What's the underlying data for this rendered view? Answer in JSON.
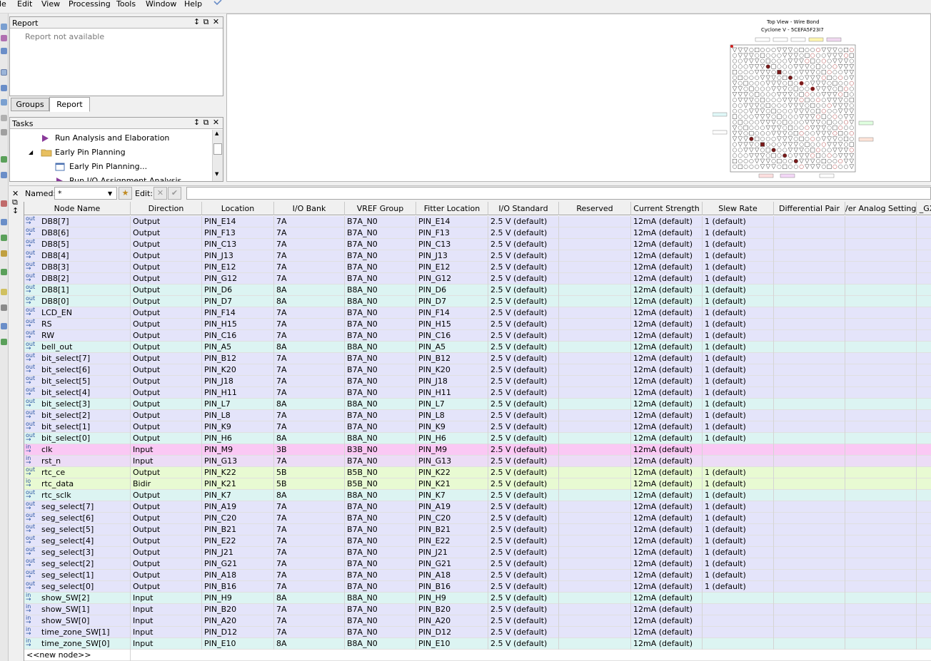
{
  "menu": [
    "le",
    "Edit",
    "View",
    "Processing",
    "Tools",
    "Window",
    "Help"
  ],
  "report_panel": {
    "title": "Report",
    "message": "Report not available"
  },
  "tabs": [
    "Groups",
    "Report"
  ],
  "tasks_panel": {
    "title": "Tasks",
    "items": [
      "Run Analysis and Elaboration",
      "Early Pin Planning",
      "Early Pin Planning...",
      "Run I/O Assignment Analysis"
    ]
  },
  "package_view": {
    "title": "Top View - Wire Bond",
    "subtitle": "Cyclone V - 5CEFA5F23I7"
  },
  "filter": {
    "named_label": "Named:",
    "named_value": "*",
    "edit_label": "Edit:"
  },
  "columns": [
    "Node Name",
    "Direction",
    "Location",
    "I/O Bank",
    "VREF Group",
    "Fitter Location",
    "I/O Standard",
    "Reserved",
    "Current Strength",
    "Slew Rate",
    "Differential Pair",
    "/er Analog Settings",
    "_GX"
  ],
  "colors": {
    "purple": "#e4e4fa",
    "cyan": "#dcf4f2",
    "pink": "#fac8f4",
    "lavender": "#ecdcf6",
    "green": "#e8fad2",
    "white": "#ffffff"
  },
  "rows": [
    {
      "icon": "out",
      "name": "DB8[7]",
      "direction": "Output",
      "location": "PIN_E14",
      "bank": "7A",
      "vref": "B7A_N0",
      "fitter": "PIN_E14",
      "standard": "2.5 V (default)",
      "reserved": "",
      "current": "12mA (default)",
      "slew": "1 (default)",
      "color": "purple"
    },
    {
      "icon": "out",
      "name": "DB8[6]",
      "direction": "Output",
      "location": "PIN_F13",
      "bank": "7A",
      "vref": "B7A_N0",
      "fitter": "PIN_F13",
      "standard": "2.5 V (default)",
      "reserved": "",
      "current": "12mA (default)",
      "slew": "1 (default)",
      "color": "purple"
    },
    {
      "icon": "out",
      "name": "DB8[5]",
      "direction": "Output",
      "location": "PIN_C13",
      "bank": "7A",
      "vref": "B7A_N0",
      "fitter": "PIN_C13",
      "standard": "2.5 V (default)",
      "reserved": "",
      "current": "12mA (default)",
      "slew": "1 (default)",
      "color": "purple"
    },
    {
      "icon": "out",
      "name": "DB8[4]",
      "direction": "Output",
      "location": "PIN_J13",
      "bank": "7A",
      "vref": "B7A_N0",
      "fitter": "PIN_J13",
      "standard": "2.5 V (default)",
      "reserved": "",
      "current": "12mA (default)",
      "slew": "1 (default)",
      "color": "purple"
    },
    {
      "icon": "out",
      "name": "DB8[3]",
      "direction": "Output",
      "location": "PIN_E12",
      "bank": "7A",
      "vref": "B7A_N0",
      "fitter": "PIN_E12",
      "standard": "2.5 V (default)",
      "reserved": "",
      "current": "12mA (default)",
      "slew": "1 (default)",
      "color": "purple"
    },
    {
      "icon": "out",
      "name": "DB8[2]",
      "direction": "Output",
      "location": "PIN_G12",
      "bank": "7A",
      "vref": "B7A_N0",
      "fitter": "PIN_G12",
      "standard": "2.5 V (default)",
      "reserved": "",
      "current": "12mA (default)",
      "slew": "1 (default)",
      "color": "purple"
    },
    {
      "icon": "out",
      "name": "DB8[1]",
      "direction": "Output",
      "location": "PIN_D6",
      "bank": "8A",
      "vref": "B8A_N0",
      "fitter": "PIN_D6",
      "standard": "2.5 V (default)",
      "reserved": "",
      "current": "12mA (default)",
      "slew": "1 (default)",
      "color": "cyan"
    },
    {
      "icon": "out",
      "name": "DB8[0]",
      "direction": "Output",
      "location": "PIN_D7",
      "bank": "8A",
      "vref": "B8A_N0",
      "fitter": "PIN_D7",
      "standard": "2.5 V (default)",
      "reserved": "",
      "current": "12mA (default)",
      "slew": "1 (default)",
      "color": "cyan"
    },
    {
      "icon": "out",
      "name": "LCD_EN",
      "direction": "Output",
      "location": "PIN_F14",
      "bank": "7A",
      "vref": "B7A_N0",
      "fitter": "PIN_F14",
      "standard": "2.5 V (default)",
      "reserved": "",
      "current": "12mA (default)",
      "slew": "1 (default)",
      "color": "purple"
    },
    {
      "icon": "out",
      "name": "RS",
      "direction": "Output",
      "location": "PIN_H15",
      "bank": "7A",
      "vref": "B7A_N0",
      "fitter": "PIN_H15",
      "standard": "2.5 V (default)",
      "reserved": "",
      "current": "12mA (default)",
      "slew": "1 (default)",
      "color": "purple"
    },
    {
      "icon": "out",
      "name": "RW",
      "direction": "Output",
      "location": "PIN_C16",
      "bank": "7A",
      "vref": "B7A_N0",
      "fitter": "PIN_C16",
      "standard": "2.5 V (default)",
      "reserved": "",
      "current": "12mA (default)",
      "slew": "1 (default)",
      "color": "purple"
    },
    {
      "icon": "out",
      "name": "bell_out",
      "direction": "Output",
      "location": "PIN_A5",
      "bank": "8A",
      "vref": "B8A_N0",
      "fitter": "PIN_A5",
      "standard": "2.5 V (default)",
      "reserved": "",
      "current": "12mA (default)",
      "slew": "1 (default)",
      "color": "cyan"
    },
    {
      "icon": "out",
      "name": "bit_select[7]",
      "direction": "Output",
      "location": "PIN_B12",
      "bank": "7A",
      "vref": "B7A_N0",
      "fitter": "PIN_B12",
      "standard": "2.5 V (default)",
      "reserved": "",
      "current": "12mA (default)",
      "slew": "1 (default)",
      "color": "purple"
    },
    {
      "icon": "out",
      "name": "bit_select[6]",
      "direction": "Output",
      "location": "PIN_K20",
      "bank": "7A",
      "vref": "B7A_N0",
      "fitter": "PIN_K20",
      "standard": "2.5 V (default)",
      "reserved": "",
      "current": "12mA (default)",
      "slew": "1 (default)",
      "color": "purple"
    },
    {
      "icon": "out",
      "name": "bit_select[5]",
      "direction": "Output",
      "location": "PIN_J18",
      "bank": "7A",
      "vref": "B7A_N0",
      "fitter": "PIN_J18",
      "standard": "2.5 V (default)",
      "reserved": "",
      "current": "12mA (default)",
      "slew": "1 (default)",
      "color": "purple"
    },
    {
      "icon": "out",
      "name": "bit_select[4]",
      "direction": "Output",
      "location": "PIN_H11",
      "bank": "7A",
      "vref": "B7A_N0",
      "fitter": "PIN_H11",
      "standard": "2.5 V (default)",
      "reserved": "",
      "current": "12mA (default)",
      "slew": "1 (default)",
      "color": "purple"
    },
    {
      "icon": "out",
      "name": "bit_select[3]",
      "direction": "Output",
      "location": "PIN_L7",
      "bank": "8A",
      "vref": "B8A_N0",
      "fitter": "PIN_L7",
      "standard": "2.5 V (default)",
      "reserved": "",
      "current": "12mA (default)",
      "slew": "1 (default)",
      "color": "cyan"
    },
    {
      "icon": "out",
      "name": "bit_select[2]",
      "direction": "Output",
      "location": "PIN_L8",
      "bank": "7A",
      "vref": "B7A_N0",
      "fitter": "PIN_L8",
      "standard": "2.5 V (default)",
      "reserved": "",
      "current": "12mA (default)",
      "slew": "1 (default)",
      "color": "purple"
    },
    {
      "icon": "out",
      "name": "bit_select[1]",
      "direction": "Output",
      "location": "PIN_K9",
      "bank": "7A",
      "vref": "B7A_N0",
      "fitter": "PIN_K9",
      "standard": "2.5 V (default)",
      "reserved": "",
      "current": "12mA (default)",
      "slew": "1 (default)",
      "color": "purple"
    },
    {
      "icon": "out",
      "name": "bit_select[0]",
      "direction": "Output",
      "location": "PIN_H6",
      "bank": "8A",
      "vref": "B8A_N0",
      "fitter": "PIN_H6",
      "standard": "2.5 V (default)",
      "reserved": "",
      "current": "12mA (default)",
      "slew": "1 (default)",
      "color": "cyan"
    },
    {
      "icon": "in",
      "name": "clk",
      "direction": "Input",
      "location": "PIN_M9",
      "bank": "3B",
      "vref": "B3B_N0",
      "fitter": "PIN_M9",
      "standard": "2.5 V (default)",
      "reserved": "",
      "current": "12mA (default)",
      "slew": "",
      "color": "pink"
    },
    {
      "icon": "in",
      "name": "rst_n",
      "direction": "Input",
      "location": "PIN_G13",
      "bank": "7A",
      "vref": "B7A_N0",
      "fitter": "PIN_G13",
      "standard": "2.5 V (default)",
      "reserved": "",
      "current": "12mA (default)",
      "slew": "",
      "color": "lavender"
    },
    {
      "icon": "out",
      "name": "rtc_ce",
      "direction": "Output",
      "location": "PIN_K22",
      "bank": "5B",
      "vref": "B5B_N0",
      "fitter": "PIN_K22",
      "standard": "2.5 V (default)",
      "reserved": "",
      "current": "12mA (default)",
      "slew": "1 (default)",
      "color": "green"
    },
    {
      "icon": "io",
      "name": "rtc_data",
      "direction": "Bidir",
      "location": "PIN_K21",
      "bank": "5B",
      "vref": "B5B_N0",
      "fitter": "PIN_K21",
      "standard": "2.5 V (default)",
      "reserved": "",
      "current": "12mA (default)",
      "slew": "1 (default)",
      "color": "green"
    },
    {
      "icon": "out",
      "name": "rtc_sclk",
      "direction": "Output",
      "location": "PIN_K7",
      "bank": "8A",
      "vref": "B8A_N0",
      "fitter": "PIN_K7",
      "standard": "2.5 V (default)",
      "reserved": "",
      "current": "12mA (default)",
      "slew": "1 (default)",
      "color": "cyan"
    },
    {
      "icon": "out",
      "name": "seg_select[7]",
      "direction": "Output",
      "location": "PIN_A19",
      "bank": "7A",
      "vref": "B7A_N0",
      "fitter": "PIN_A19",
      "standard": "2.5 V (default)",
      "reserved": "",
      "current": "12mA (default)",
      "slew": "1 (default)",
      "color": "purple"
    },
    {
      "icon": "out",
      "name": "seg_select[6]",
      "direction": "Output",
      "location": "PIN_C20",
      "bank": "7A",
      "vref": "B7A_N0",
      "fitter": "PIN_C20",
      "standard": "2.5 V (default)",
      "reserved": "",
      "current": "12mA (default)",
      "slew": "1 (default)",
      "color": "purple"
    },
    {
      "icon": "out",
      "name": "seg_select[5]",
      "direction": "Output",
      "location": "PIN_B21",
      "bank": "7A",
      "vref": "B7A_N0",
      "fitter": "PIN_B21",
      "standard": "2.5 V (default)",
      "reserved": "",
      "current": "12mA (default)",
      "slew": "1 (default)",
      "color": "purple"
    },
    {
      "icon": "out",
      "name": "seg_select[4]",
      "direction": "Output",
      "location": "PIN_E22",
      "bank": "7A",
      "vref": "B7A_N0",
      "fitter": "PIN_E22",
      "standard": "2.5 V (default)",
      "reserved": "",
      "current": "12mA (default)",
      "slew": "1 (default)",
      "color": "purple"
    },
    {
      "icon": "out",
      "name": "seg_select[3]",
      "direction": "Output",
      "location": "PIN_J21",
      "bank": "7A",
      "vref": "B7A_N0",
      "fitter": "PIN_J21",
      "standard": "2.5 V (default)",
      "reserved": "",
      "current": "12mA (default)",
      "slew": "1 (default)",
      "color": "purple"
    },
    {
      "icon": "out",
      "name": "seg_select[2]",
      "direction": "Output",
      "location": "PIN_G21",
      "bank": "7A",
      "vref": "B7A_N0",
      "fitter": "PIN_G21",
      "standard": "2.5 V (default)",
      "reserved": "",
      "current": "12mA (default)",
      "slew": "1 (default)",
      "color": "purple"
    },
    {
      "icon": "out",
      "name": "seg_select[1]",
      "direction": "Output",
      "location": "PIN_A18",
      "bank": "7A",
      "vref": "B7A_N0",
      "fitter": "PIN_A18",
      "standard": "2.5 V (default)",
      "reserved": "",
      "current": "12mA (default)",
      "slew": "1 (default)",
      "color": "purple"
    },
    {
      "icon": "out",
      "name": "seg_select[0]",
      "direction": "Output",
      "location": "PIN_B16",
      "bank": "7A",
      "vref": "B7A_N0",
      "fitter": "PIN_B16",
      "standard": "2.5 V (default)",
      "reserved": "",
      "current": "12mA (default)",
      "slew": "1 (default)",
      "color": "purple"
    },
    {
      "icon": "in",
      "name": "show_SW[2]",
      "direction": "Input",
      "location": "PIN_H9",
      "bank": "8A",
      "vref": "B8A_N0",
      "fitter": "PIN_H9",
      "standard": "2.5 V (default)",
      "reserved": "",
      "current": "12mA (default)",
      "slew": "",
      "color": "cyan"
    },
    {
      "icon": "in",
      "name": "show_SW[1]",
      "direction": "Input",
      "location": "PIN_B20",
      "bank": "7A",
      "vref": "B7A_N0",
      "fitter": "PIN_B20",
      "standard": "2.5 V (default)",
      "reserved": "",
      "current": "12mA (default)",
      "slew": "",
      "color": "purple"
    },
    {
      "icon": "in",
      "name": "show_SW[0]",
      "direction": "Input",
      "location": "PIN_A20",
      "bank": "7A",
      "vref": "B7A_N0",
      "fitter": "PIN_A20",
      "standard": "2.5 V (default)",
      "reserved": "",
      "current": "12mA (default)",
      "slew": "",
      "color": "purple"
    },
    {
      "icon": "in",
      "name": "time_zone_SW[1]",
      "direction": "Input",
      "location": "PIN_D12",
      "bank": "7A",
      "vref": "B7A_N0",
      "fitter": "PIN_D12",
      "standard": "2.5 V (default)",
      "reserved": "",
      "current": "12mA (default)",
      "slew": "",
      "color": "purple"
    },
    {
      "icon": "in",
      "name": "time_zone_SW[0]",
      "direction": "Input",
      "location": "PIN_E10",
      "bank": "8A",
      "vref": "B8A_N0",
      "fitter": "PIN_E10",
      "standard": "2.5 V (default)",
      "reserved": "",
      "current": "12mA (default)",
      "slew": "",
      "color": "cyan"
    }
  ],
  "new_node_label": "<<new node>>"
}
